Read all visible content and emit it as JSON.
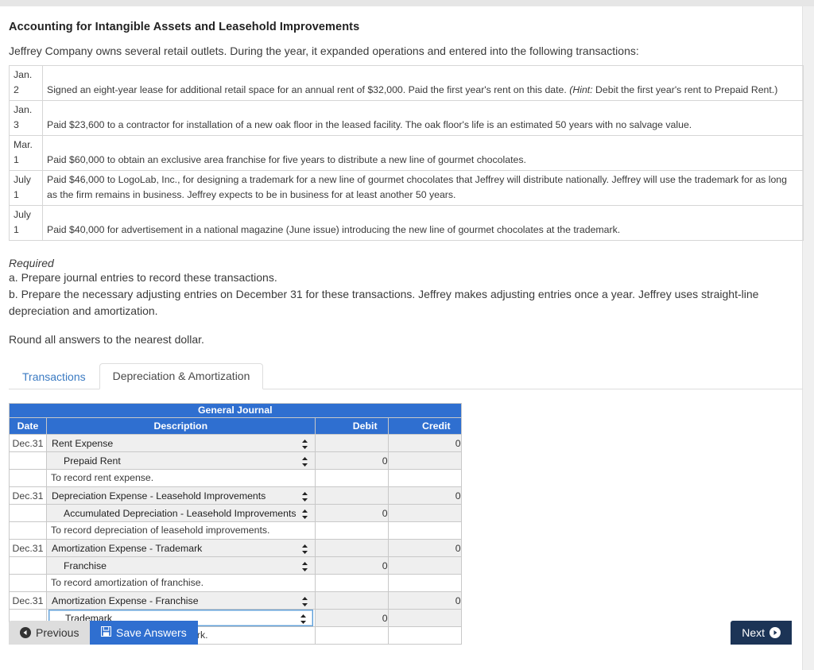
{
  "page": {
    "title": "Accounting for Intangible Assets and Leasehold Improvements",
    "intro": "Jeffrey Company owns several retail outlets. During the year, it expanded operations and entered into the following transactions:"
  },
  "transactions": [
    {
      "month": "Jan.",
      "day": "2",
      "text": "Signed an eight-year lease for additional retail space for an annual rent of $32,000. Paid the first year's rent on this date. ",
      "hint": "(Hint:",
      "text_after": " Debit the first year's rent to Prepaid Rent.)"
    },
    {
      "month": "Jan.",
      "day": "3",
      "text": "Paid $23,600 to a contractor for installation of a new oak floor in the leased facility. The oak floor's life is an estimated 50 years with no salvage value.",
      "hint": "",
      "text_after": ""
    },
    {
      "month": "Mar.",
      "day": "1",
      "text": "Paid $60,000 to obtain an exclusive area franchise for five years to distribute a new line of gourmet chocolates.",
      "hint": "",
      "text_after": ""
    },
    {
      "month": "July",
      "day": "1",
      "text": "Paid $46,000 to LogoLab, Inc., for designing a trademark for a new line of gourmet chocolates that Jeffrey will distribute nationally. Jeffrey will use the trademark for as long as the firm remains in business. Jeffrey expects to be in business for at least another 50 years.",
      "hint": "",
      "text_after": ""
    },
    {
      "month": "July",
      "day": "1",
      "text": "Paid $40,000 for advertisement in a national magazine (June issue) introducing the new line of gourmet chocolates at the trademark.",
      "hint": "",
      "text_after": ""
    }
  ],
  "required": {
    "label": "Required",
    "items": [
      "a. Prepare journal entries to record these transactions.",
      "b. Prepare the necessary adjusting entries on December 31 for these transactions. Jeffrey makes adjusting entries once a year. Jeffrey uses straight-line depreciation and amortization."
    ],
    "note": "Round all answers to the nearest dollar."
  },
  "tabs": [
    {
      "label": "Transactions",
      "active": false
    },
    {
      "label": "Depreciation & Amortization",
      "active": true
    }
  ],
  "journal": {
    "title": "General Journal",
    "columns": [
      "Date",
      "Description",
      "Debit",
      "Credit"
    ],
    "rows": [
      {
        "kind": "account",
        "date": "Dec.31",
        "description": "Rent Expense",
        "indent": false,
        "focused": false,
        "debit": "",
        "credit": "0",
        "entry_start": true
      },
      {
        "kind": "account",
        "date": "",
        "description": "Prepaid Rent",
        "indent": true,
        "focused": false,
        "debit": "0",
        "credit": "",
        "entry_start": false
      },
      {
        "kind": "memo",
        "date": "",
        "description": "To record rent expense.",
        "indent": false,
        "focused": false,
        "debit": "",
        "credit": "",
        "entry_start": false
      },
      {
        "kind": "account",
        "date": "Dec.31",
        "description": "Depreciation Expense - Leasehold Improvements",
        "indent": false,
        "focused": false,
        "debit": "",
        "credit": "0",
        "entry_start": true
      },
      {
        "kind": "account",
        "date": "",
        "description": "Accumulated Depreciation - Leasehold Improvements",
        "indent": true,
        "focused": false,
        "debit": "0",
        "credit": "",
        "entry_start": false
      },
      {
        "kind": "memo",
        "date": "",
        "description": "To record depreciation of leasehold improvements.",
        "indent": false,
        "focused": false,
        "debit": "",
        "credit": "",
        "entry_start": false
      },
      {
        "kind": "account",
        "date": "Dec.31",
        "description": "Amortization Expense - Trademark",
        "indent": false,
        "focused": false,
        "debit": "",
        "credit": "0",
        "entry_start": true
      },
      {
        "kind": "account",
        "date": "",
        "description": "Franchise",
        "indent": true,
        "focused": false,
        "debit": "0",
        "credit": "",
        "entry_start": false
      },
      {
        "kind": "memo",
        "date": "",
        "description": "To record amortization of franchise.",
        "indent": false,
        "focused": false,
        "debit": "",
        "credit": "",
        "entry_start": false
      },
      {
        "kind": "account",
        "date": "Dec.31",
        "description": "Amortization Expense - Franchise",
        "indent": false,
        "focused": false,
        "debit": "",
        "credit": "0",
        "entry_start": true
      },
      {
        "kind": "account",
        "date": "",
        "description": "Trademark",
        "indent": true,
        "focused": true,
        "debit": "0",
        "credit": "",
        "entry_start": false
      },
      {
        "kind": "memo",
        "date": "",
        "description": "To record amortization of trademark.",
        "indent": false,
        "focused": false,
        "debit": "",
        "credit": "",
        "entry_start": false
      }
    ]
  },
  "footer": {
    "previous_label": "Previous",
    "save_label": "Save Answers",
    "next_label": "Next"
  },
  "colors": {
    "header_blue": "#2f6fd0",
    "tab_link_blue": "#3a7ac2",
    "next_navy": "#1c3456",
    "prev_gray": "#dddddd"
  }
}
